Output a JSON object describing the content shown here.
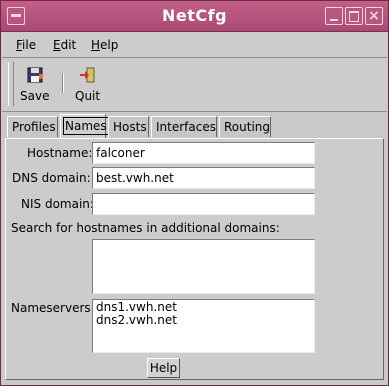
{
  "window": {
    "title": "NetCfg"
  },
  "menu": {
    "file": "ile",
    "file_key": "F",
    "edit": "dit",
    "edit_key": "E",
    "help": "elp",
    "help_key": "H"
  },
  "toolbar": {
    "save_label": "Save",
    "quit_label": "Quit",
    "save_icon": "floppy-disk-icon",
    "quit_icon": "exit-door-icon"
  },
  "tabs": [
    "Profiles",
    "Names",
    "Hosts",
    "Interfaces",
    "Routing"
  ],
  "active_tab": "Names",
  "form": {
    "hostname_label": "Hostname:",
    "hostname_value": "falconer",
    "dns_label": "DNS domain:",
    "dns_value": "best.vwh.net",
    "nis_label": "NIS domain:",
    "nis_value": "",
    "search_label": "Search for hostnames in additional domains:",
    "search_value": "",
    "nameservers_label": "Nameservers:",
    "nameservers": [
      "dns1.vwh.net",
      "dns2.vwh.net"
    ]
  },
  "help_button": "Help",
  "colors": {
    "titlebar": "#b9567e",
    "window_bg": "#cccccc"
  }
}
